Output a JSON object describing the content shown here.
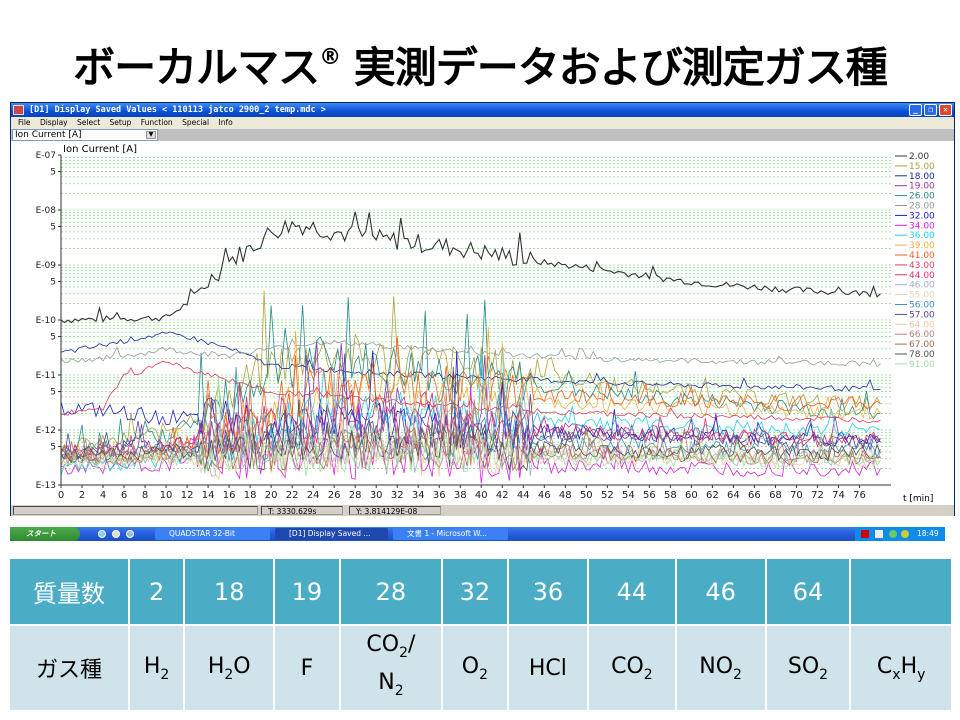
{
  "slide": {
    "title": "ボーカルマス",
    "title_mark": "®",
    "title_rest": " 実測データおよび測定ガス種"
  },
  "window": {
    "title": "[D1] Display Saved Values  < 110113 jatco 2900_2 temp.mdc >",
    "controls": {
      "minimize": "_",
      "restore": "❐",
      "close": "✕"
    },
    "menu": [
      "File",
      "Display",
      "Select",
      "Setup",
      "Function",
      "Special",
      "Info"
    ],
    "combo_value": "Ion Current [A]",
    "status": {
      "t": "T: 3330.629s",
      "y": "Y: 3.814129E-08"
    }
  },
  "chart_data": {
    "type": "line",
    "title": "Ion Current [A]",
    "xlabel": "t [min]",
    "ylabel": "Ion Current [A]",
    "yscale": "log",
    "ylim": [
      1e-13,
      1e-07
    ],
    "xlim": [
      0,
      79
    ],
    "x_ticks": [
      0,
      2,
      4,
      6,
      8,
      10,
      12,
      14,
      16,
      18,
      20,
      22,
      24,
      26,
      28,
      30,
      32,
      34,
      36,
      38,
      40,
      42,
      44,
      46,
      48,
      50,
      52,
      54,
      56,
      58,
      60,
      62,
      64,
      66,
      68,
      70,
      72,
      74,
      76
    ],
    "y_tick_labels": [
      {
        "v": 1e-07,
        "label": "E-07"
      },
      {
        "v": 5e-08,
        "label": "5"
      },
      {
        "v": 1e-08,
        "label": "E-08"
      },
      {
        "v": 5e-09,
        "label": "5"
      },
      {
        "v": 1e-09,
        "label": "E-09"
      },
      {
        "v": 5e-10,
        "label": "5"
      },
      {
        "v": 1e-10,
        "label": "E-10"
      },
      {
        "v": 5e-11,
        "label": "5"
      },
      {
        "v": 1e-11,
        "label": "E-11"
      },
      {
        "v": 5e-12,
        "label": "5"
      },
      {
        "v": 1e-12,
        "label": "E-12"
      },
      {
        "v": 5e-13,
        "label": "5"
      },
      {
        "v": 1e-13,
        "label": "E-13"
      }
    ],
    "grid": true,
    "legend_position": "right",
    "series": [
      {
        "name": "2.00",
        "color": "#333333",
        "x": [
          0,
          5,
          10,
          12,
          14,
          16,
          18,
          20,
          22,
          24,
          26,
          28,
          30,
          34,
          38,
          42,
          46,
          50,
          54,
          58,
          62,
          66,
          70,
          74,
          78
        ],
        "y": [
          1e-10,
          1.05e-10,
          1.1e-10,
          2e-10,
          5e-10,
          1.2e-09,
          2e-09,
          4e-09,
          5.5e-09,
          5e-09,
          4e-09,
          3.5e-09,
          3e-09,
          2.5e-09,
          2e-09,
          1.5e-09,
          1.1e-09,
          9e-10,
          7e-10,
          5.5e-10,
          4.5e-10,
          4e-10,
          3.5e-10,
          3.2e-10,
          3e-10
        ]
      },
      {
        "name": "15.00",
        "color": "#b0a040",
        "x": [
          0,
          5,
          10,
          15,
          20,
          25,
          30,
          35,
          40,
          45,
          50,
          55,
          60,
          65,
          70,
          75,
          78
        ],
        "y": [
          5e-13,
          6e-13,
          1e-12,
          3e-12,
          1.5e-11,
          2.5e-11,
          2e-11,
          1.6e-11,
          1.3e-11,
          1e-11,
          8e-12,
          6e-12,
          5e-12,
          4e-12,
          3.5e-12,
          3e-12,
          3e-12
        ]
      },
      {
        "name": "18.00",
        "color": "#1c2a9c",
        "x": [
          0,
          4,
          8,
          10,
          12,
          16,
          20,
          30,
          40,
          50,
          60,
          70,
          78
        ],
        "y": [
          2.5e-11,
          3.5e-11,
          5e-11,
          5.5e-11,
          5e-11,
          3e-11,
          1.5e-11,
          1.1e-11,
          9e-12,
          7.5e-12,
          6.5e-12,
          6e-12,
          5.5e-12
        ]
      },
      {
        "name": "19.00",
        "color": "#a030a0",
        "x": [
          0,
          10,
          15,
          20,
          25,
          30,
          35,
          40,
          50,
          60,
          70,
          78
        ],
        "y": [
          4e-13,
          5e-13,
          8e-13,
          1.5e-12,
          2.5e-12,
          3e-12,
          2e-12,
          1.5e-12,
          1e-12,
          8e-13,
          7e-13,
          6e-13
        ]
      },
      {
        "name": "26.00",
        "color": "#2a8a8a",
        "x": [
          0,
          5,
          10,
          15,
          20,
          25,
          30,
          35,
          40,
          45,
          50,
          55,
          60,
          65,
          70,
          75,
          78
        ],
        "y": [
          4e-13,
          5e-13,
          8e-13,
          2.5e-12,
          1.2e-11,
          2e-11,
          1.5e-11,
          1.2e-11,
          9e-12,
          7e-12,
          5e-12,
          4e-12,
          3.5e-12,
          3e-12,
          2.5e-12,
          2e-12,
          2e-12
        ]
      },
      {
        "name": "28.00",
        "color": "#999999",
        "x": [
          0,
          4,
          8,
          10,
          12,
          16,
          20,
          25,
          30,
          40,
          50,
          60,
          70,
          78
        ],
        "y": [
          1.8e-11,
          2e-11,
          2.5e-11,
          3e-11,
          2.6e-11,
          2.3e-11,
          3e-11,
          4e-11,
          3.5e-11,
          2.5e-11,
          2e-11,
          1.8e-11,
          1.7e-11,
          1.6e-11
        ]
      },
      {
        "name": "32.00",
        "color": "#2020c0",
        "x": [
          0,
          4,
          8,
          12,
          16,
          20,
          25,
          30,
          40,
          50,
          60,
          70,
          78
        ],
        "y": [
          2.5e-12,
          2.2e-12,
          1.8e-12,
          1.6e-12,
          1.4e-12,
          1.2e-12,
          1.6e-12,
          1.3e-12,
          1e-12,
          9e-13,
          8e-13,
          7e-13,
          7e-13
        ]
      },
      {
        "name": "34.00",
        "color": "#e020e0",
        "x": [
          0,
          10,
          20,
          30,
          40,
          50,
          60,
          70,
          78
        ],
        "y": [
          2e-13,
          2.5e-13,
          3e-13,
          3e-13,
          2.5e-13,
          2.2e-13,
          2e-13,
          2e-13,
          2e-13
        ]
      },
      {
        "name": "36.00",
        "color": "#20d0f0",
        "x": [
          0,
          10,
          15,
          20,
          25,
          30,
          40,
          50,
          60,
          70,
          78
        ],
        "y": [
          2e-13,
          3e-13,
          5e-13,
          1e-12,
          2e-12,
          2.5e-12,
          1.8e-12,
          1.4e-12,
          1.2e-12,
          1e-12,
          1e-12
        ]
      },
      {
        "name": "39.00",
        "color": "#f0b040",
        "x": [
          0,
          10,
          15,
          20,
          25,
          30,
          40,
          50,
          60,
          70,
          78
        ],
        "y": [
          3e-13,
          4e-13,
          8e-13,
          2e-12,
          4e-12,
          5e-12,
          3.5e-12,
          2.8e-12,
          2.5e-12,
          2.2e-12,
          2e-12
        ]
      },
      {
        "name": "41.00",
        "color": "#f06020",
        "x": [
          0,
          10,
          15,
          20,
          25,
          30,
          40,
          50,
          60,
          70,
          78
        ],
        "y": [
          3e-13,
          4e-13,
          9e-13,
          3e-12,
          6e-12,
          7e-12,
          5e-12,
          4e-12,
          3.5e-12,
          3e-12,
          3e-12
        ]
      },
      {
        "name": "43.00",
        "color": "#e04060",
        "x": [
          0,
          4,
          6,
          8,
          10,
          12,
          16,
          20,
          30,
          40,
          50,
          60,
          70,
          78
        ],
        "y": [
          2e-12,
          2.5e-12,
          1e-11,
          1.2e-11,
          1.8e-11,
          1.3e-11,
          8e-12,
          5e-12,
          3.5e-12,
          2.5e-12,
          2e-12,
          1.8e-12,
          1.6e-12,
          1.5e-12
        ]
      },
      {
        "name": "44.00",
        "color": "#e03070",
        "x": [
          0,
          10,
          20,
          30,
          40,
          50,
          60,
          70,
          78
        ],
        "y": [
          4e-13,
          5e-13,
          9e-13,
          1.2e-12,
          1e-12,
          9e-13,
          8e-13,
          7e-13,
          7e-13
        ]
      },
      {
        "name": "46.00",
        "color": "#a0b0d0",
        "x": [
          0,
          10,
          20,
          30,
          40,
          50,
          60,
          70,
          78
        ],
        "y": [
          3e-13,
          3.5e-13,
          4e-13,
          4.5e-13,
          4e-13,
          3.5e-13,
          3.2e-13,
          3e-13,
          3e-13
        ]
      },
      {
        "name": "55.00",
        "color": "#e0d8b0",
        "x": [
          0,
          10,
          20,
          30,
          40,
          50,
          60,
          70,
          78
        ],
        "y": [
          3e-13,
          3.5e-13,
          5e-13,
          6e-13,
          5e-13,
          4e-13,
          3.5e-13,
          3e-13,
          3e-13
        ]
      },
      {
        "name": "56.00",
        "color": "#4090c0",
        "x": [
          0,
          10,
          20,
          30,
          40,
          50,
          60,
          70,
          78
        ],
        "y": [
          3.5e-13,
          4e-13,
          6e-13,
          8e-13,
          7e-13,
          6e-13,
          5e-13,
          4.5e-13,
          4.5e-13
        ]
      },
      {
        "name": "57.00",
        "color": "#6040a0",
        "x": [
          0,
          10,
          20,
          30,
          40,
          50,
          60,
          70,
          78
        ],
        "y": [
          4e-13,
          5e-13,
          8e-13,
          1.1e-12,
          9e-13,
          8e-13,
          7e-13,
          6e-13,
          6e-13
        ]
      },
      {
        "name": "64.00",
        "color": "#f0c8a0",
        "x": [
          0,
          10,
          20,
          30,
          40,
          50,
          60,
          70,
          78
        ],
        "y": [
          2.5e-13,
          3e-13,
          3.5e-13,
          4e-13,
          3.5e-13,
          3e-13,
          3e-13,
          2.8e-13,
          2.8e-13
        ]
      },
      {
        "name": "66.00",
        "color": "#c08080",
        "x": [
          0,
          10,
          20,
          30,
          40,
          50,
          60,
          70,
          78
        ],
        "y": [
          3e-13,
          3.5e-13,
          4e-13,
          5e-13,
          4.5e-13,
          4e-13,
          3.5e-13,
          3.2e-13,
          3.2e-13
        ]
      },
      {
        "name": "67.00",
        "color": "#a07050",
        "x": [
          0,
          10,
          20,
          30,
          40,
          50,
          60,
          70,
          78
        ],
        "y": [
          3e-13,
          3.5e-13,
          4.5e-13,
          5.5e-13,
          5e-13,
          4e-13,
          3.5e-13,
          3.2e-13,
          3.2e-13
        ]
      },
      {
        "name": "78.00",
        "color": "#505050",
        "x": [
          0,
          10,
          20,
          30,
          40,
          50,
          60,
          70,
          78
        ],
        "y": [
          3.5e-13,
          4e-13,
          5e-13,
          6e-13,
          5e-13,
          4.5e-13,
          4e-13,
          3.8e-13,
          3.8e-13
        ]
      },
      {
        "name": "91.00",
        "color": "#a0e0a0",
        "x": [
          0,
          10,
          20,
          30,
          40,
          50,
          60,
          70,
          78
        ],
        "y": [
          2.5e-13,
          3e-13,
          3.5e-13,
          4e-13,
          3.5e-13,
          3e-13,
          3e-13,
          2.8e-13,
          2.8e-13
        ]
      }
    ]
  },
  "taskbar": {
    "start": "スタート",
    "tasks": [
      "QUADSTAR 32-Bit",
      "[D1] Display Saved ...",
      "文書 1 - Microsoft W..."
    ],
    "clock": "18:49"
  },
  "gas_table": {
    "row1_header": "質量数",
    "row2_header": "ガス種",
    "mass_numbers": [
      "2",
      "18",
      "19",
      "28",
      "32",
      "36",
      "44",
      "46",
      "64",
      ""
    ],
    "gases": [
      {
        "base": "H",
        "sub": "2",
        "tail": ""
      },
      {
        "base": "H",
        "sub": "2",
        "tail": "O"
      },
      {
        "base": "F",
        "sub": "",
        "tail": ""
      },
      {
        "base": "CO",
        "sub": "2",
        "tail": "/",
        "line2": "N",
        "line2_sub": "2"
      },
      {
        "base": "O",
        "sub": "2",
        "tail": ""
      },
      {
        "base": "HCl",
        "sub": "",
        "tail": ""
      },
      {
        "base": "CO",
        "sub": "2",
        "tail": ""
      },
      {
        "base": "NO",
        "sub": "2",
        "tail": ""
      },
      {
        "base": "SO",
        "sub": "2",
        "tail": ""
      },
      {
        "base": "C",
        "sub": "x",
        "tail": "H",
        "tail_sub": "y"
      }
    ]
  }
}
